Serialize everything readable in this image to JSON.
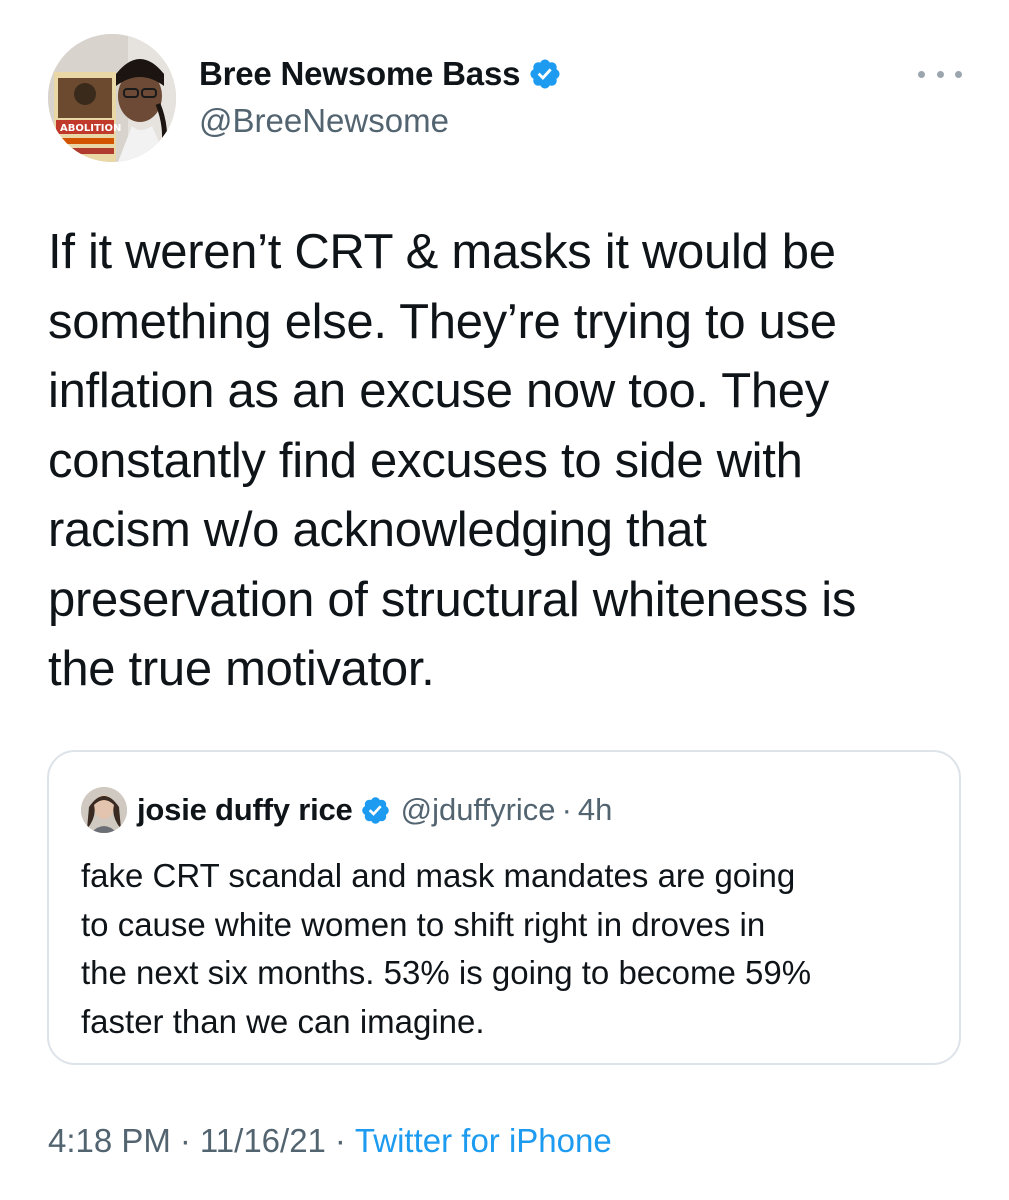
{
  "author": {
    "display_name": "Bree Newsome Bass",
    "handle": "@BreeNewsome",
    "verified_icon": "verified-badge-icon",
    "avatar_book_text": "ABOLITION"
  },
  "tweet": {
    "text": "If it weren’t CRT & masks it would be\nsomething else. They’re trying to use\ninflation as an excuse now too. They\nconstantly find excuses to side with\nracism w/o acknowledging that\npreservation of structural whiteness is\nthe true motivator."
  },
  "quoted_tweet": {
    "display_name": "josie duffy rice",
    "handle": "@jduffyrice",
    "separator": "·",
    "time": "4h",
    "text": "fake CRT scandal and mask mandates are going\nto cause white women to shift right in droves in\nthe next six months. 53% is going to become 59%\nfaster than we can imagine."
  },
  "meta": {
    "time": "4:18 PM",
    "date": "11/16/21",
    "separator": "·",
    "source": "Twitter for iPhone"
  },
  "colors": {
    "verified_blue": "#1d9bf0",
    "text_primary": "#0f1419",
    "text_secondary": "#536471",
    "border": "#dde3e8"
  }
}
